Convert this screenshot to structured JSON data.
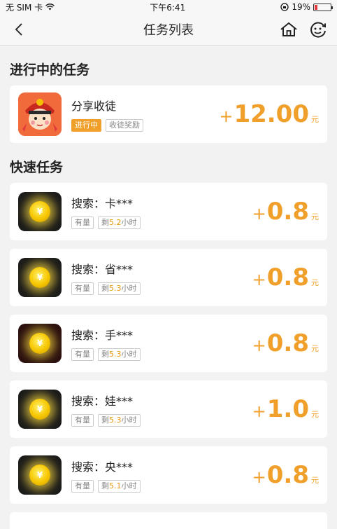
{
  "status": {
    "carrier": "无 SIM 卡",
    "time": "下午6:41",
    "battery": "19%",
    "battery_level": 0.19
  },
  "nav": {
    "title": "任务列表"
  },
  "sections": {
    "in_progress": "进行中的任务",
    "quick": "快速任务"
  },
  "active_task": {
    "name": "分享收徒",
    "tag_status": "进行中",
    "tag_type": "收徒奖励",
    "plus": "+",
    "amount": "12.00",
    "unit": "元"
  },
  "quick_tasks": [
    {
      "name": "搜索：卡***",
      "tag": "有量",
      "remain_prefix": "剩",
      "remain_value": "5.2",
      "remain_unit": "小时",
      "plus": "+",
      "amount": "0.8",
      "unit": "元"
    },
    {
      "name": "搜索：省***",
      "tag": "有量",
      "remain_prefix": "剩",
      "remain_value": "5.3",
      "remain_unit": "小时",
      "plus": "+",
      "amount": "0.8",
      "unit": "元"
    },
    {
      "name": "搜索：手***",
      "tag": "有量",
      "remain_prefix": "剩",
      "remain_value": "5.3",
      "remain_unit": "小时",
      "plus": "+",
      "amount": "0.8",
      "unit": "元"
    },
    {
      "name": "搜索：娃***",
      "tag": "有量",
      "remain_prefix": "剩",
      "remain_value": "5.3",
      "remain_unit": "小时",
      "plus": "+",
      "amount": "1.0",
      "unit": "元"
    },
    {
      "name": "搜索：央***",
      "tag": "有量",
      "remain_prefix": "剩",
      "remain_value": "5.1",
      "remain_unit": "小时",
      "plus": "+",
      "amount": "0.8",
      "unit": "元"
    }
  ],
  "coin_symbol": "¥",
  "colors": {
    "accent": "#f0a02a",
    "background": "#f2f2f2"
  }
}
